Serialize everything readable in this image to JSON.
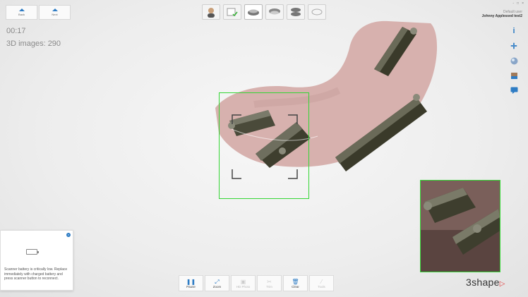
{
  "nav": {
    "back_label": "Back",
    "next_label": "Next"
  },
  "status": {
    "timer": "00:17",
    "images": "3D images: 290"
  },
  "user": {
    "label": "Default user",
    "name": "Johnny Applessed test2"
  },
  "window": {
    "controls": [
      "-",
      "□",
      "×"
    ]
  },
  "battery": {
    "message": "Scanner battery is critically low. Replace immediately with charged battery and press scanner button to reconnect."
  },
  "toolbar": {
    "pause": "Pause",
    "zoom": "Zoom",
    "photo": "HD Photo",
    "trim": "Trim",
    "clear": "Clear",
    "tools": "Tools"
  },
  "brand": {
    "name": "3shape"
  },
  "colors": {
    "accent": "#2e7cc4",
    "scan_frame": "#35d635",
    "brand_red": "#e23a3a"
  }
}
